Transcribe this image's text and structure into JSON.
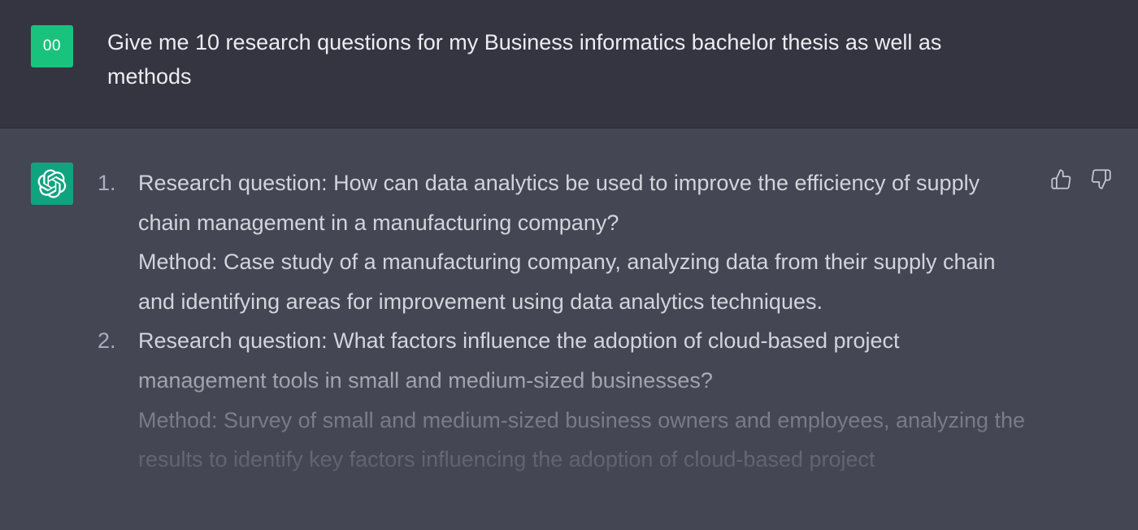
{
  "user": {
    "avatar_initials": "00",
    "message": "Give me 10 research questions for my Business informatics bachelor thesis as well as methods"
  },
  "assistant": {
    "avatar_icon": "openai-logo-icon",
    "items": [
      {
        "number": "1.",
        "question": "Research question: How can data analytics be used to improve the efficiency of supply chain management in a manufacturing company?",
        "method": "Method: Case study of a manufacturing company, analyzing data from their supply chain and identifying areas for improvement using data analytics techniques."
      },
      {
        "number": "2.",
        "question": "Research question: What factors influence the adoption of cloud-based project management tools in small and medium-sized businesses?",
        "method": "Method: Survey of small and medium-sized business owners and employees, analyzing the results to identify key factors influencing the adoption of cloud-based project"
      }
    ],
    "feedback": {
      "thumbs_up_icon": "thumbs-up-icon",
      "thumbs_down_icon": "thumbs-down-icon"
    }
  },
  "colors": {
    "user_bg": "#343541",
    "assistant_bg": "#444654",
    "user_avatar": "#19c37d",
    "assistant_avatar": "#10a37f",
    "text": "#d1d5db"
  }
}
